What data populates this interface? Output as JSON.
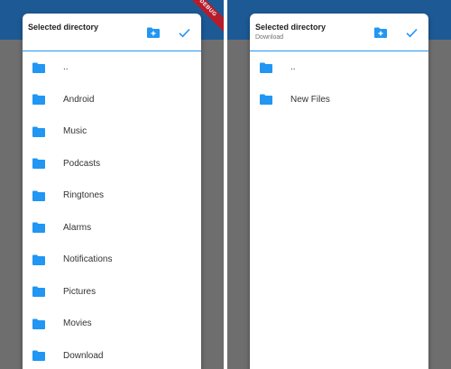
{
  "colors": {
    "accent": "#2196f3",
    "app_bar": "#1d5a95",
    "scrim": "#6e6e6e",
    "debug_ribbon": "#b71c2a"
  },
  "icons": {
    "folder": "folder-icon",
    "new_folder": "create-new-folder-icon",
    "confirm": "check-icon"
  },
  "left_panel": {
    "debug_banner": "DEBUG",
    "dialog": {
      "title": "Selected directory",
      "subtitle": "",
      "folders": [
        {
          "name": ".."
        },
        {
          "name": "Android"
        },
        {
          "name": "Music"
        },
        {
          "name": "Podcasts"
        },
        {
          "name": "Ringtones"
        },
        {
          "name": "Alarms"
        },
        {
          "name": "Notifications"
        },
        {
          "name": "Pictures"
        },
        {
          "name": "Movies"
        },
        {
          "name": "Download"
        }
      ]
    }
  },
  "right_panel": {
    "dialog": {
      "title": "Selected directory",
      "subtitle": "Download",
      "folders": [
        {
          "name": ".."
        },
        {
          "name": "New Files"
        }
      ]
    }
  }
}
